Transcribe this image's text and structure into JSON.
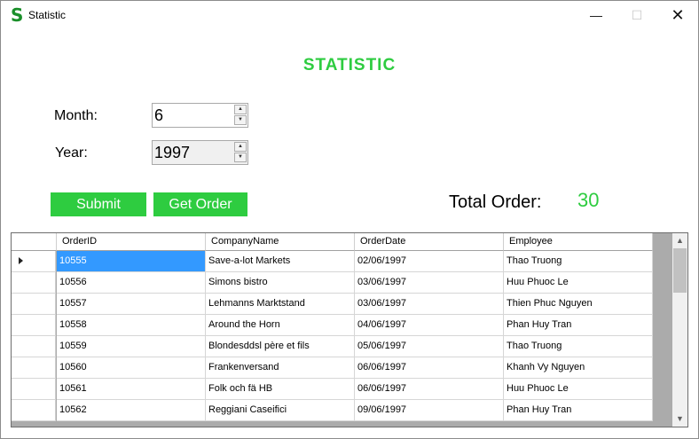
{
  "window": {
    "title": "Statistic",
    "icon": "S"
  },
  "heading": "STATISTIC",
  "month": {
    "label": "Month:",
    "value": "6"
  },
  "year": {
    "label": "Year:",
    "value": "1997"
  },
  "buttons": {
    "submit": "Submit",
    "get_order": "Get Order"
  },
  "total": {
    "label": "Total Order:",
    "value": "30"
  },
  "grid": {
    "columns": [
      "OrderID",
      "CompanyName",
      "OrderDate",
      "Employee"
    ],
    "rows": [
      [
        "10555",
        "Save-a-lot Markets",
        "02/06/1997",
        "Thao Truong"
      ],
      [
        "10556",
        "Simons bistro",
        "03/06/1997",
        "Huu Phuoc Le"
      ],
      [
        "10557",
        "Lehmanns Marktstand",
        "03/06/1997",
        "Thien Phuc Nguyen"
      ],
      [
        "10558",
        "Around the Horn",
        "04/06/1997",
        "Phan Huy Tran"
      ],
      [
        "10559",
        "Blondesddsl père et fils",
        "05/06/1997",
        "Thao Truong"
      ],
      [
        "10560",
        "Frankenversand",
        "06/06/1997",
        "Khanh Vy Nguyen"
      ],
      [
        "10561",
        "Folk och fä HB",
        "06/06/1997",
        "Huu Phuoc Le"
      ],
      [
        "10562",
        "Reggiani Caseifici",
        "09/06/1997",
        "Phan Huy Tran"
      ]
    ]
  },
  "colors": {
    "accent_green": "#2ecc40",
    "selection": "#3399ff"
  }
}
